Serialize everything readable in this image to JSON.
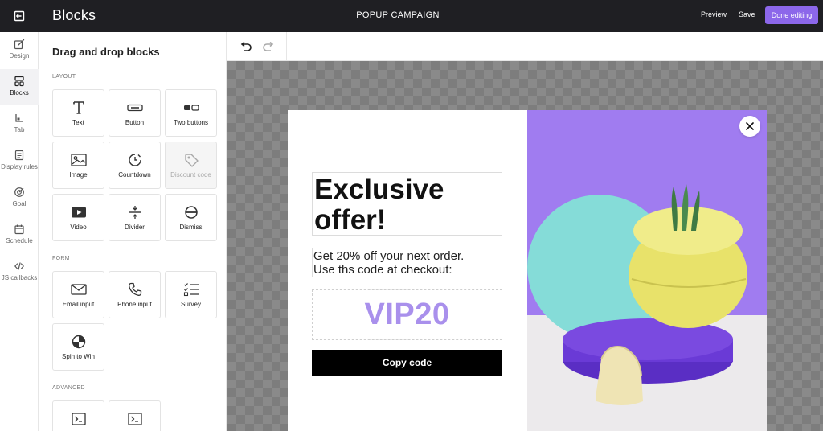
{
  "header": {
    "title": "Blocks",
    "campaign": "POPUP CAMPAIGN",
    "preview_label": "Preview",
    "save_label": "Save",
    "done_label": "Done editing",
    "exit_icon": "exit-icon"
  },
  "rail": {
    "items": [
      {
        "label": "Design",
        "icon": "pen-ruler-icon"
      },
      {
        "label": "Blocks",
        "icon": "blocks-icon",
        "active": true
      },
      {
        "label": "Tab",
        "icon": "tab-icon"
      },
      {
        "label": "Display rules",
        "icon": "document-list-icon"
      },
      {
        "label": "Goal",
        "icon": "target-icon"
      },
      {
        "label": "Schedule",
        "icon": "calendar-icon"
      },
      {
        "label": "JS callbacks",
        "icon": "code-icon"
      }
    ]
  },
  "panel": {
    "title": "Drag and drop blocks",
    "sections": {
      "layout": "LAYOUT",
      "form": "FORM",
      "advanced": "ADVANCED"
    },
    "layout_blocks": [
      {
        "label": "Text",
        "icon": "text-icon"
      },
      {
        "label": "Button",
        "icon": "button-icon"
      },
      {
        "label": "Two buttons",
        "icon": "two-buttons-icon"
      },
      {
        "label": "Image",
        "icon": "image-icon"
      },
      {
        "label": "Countdown",
        "icon": "countdown-icon"
      },
      {
        "label": "Discount code",
        "icon": "tag-icon",
        "disabled": true
      },
      {
        "label": "Video",
        "icon": "video-icon"
      },
      {
        "label": "Divider",
        "icon": "divider-icon"
      },
      {
        "label": "Dismiss",
        "icon": "dismiss-icon"
      }
    ],
    "form_blocks": [
      {
        "label": "Email input",
        "icon": "envelope-icon"
      },
      {
        "label": "Phone input",
        "icon": "phone-icon"
      },
      {
        "label": "Survey",
        "icon": "checklist-icon"
      },
      {
        "label": "Spin to Win",
        "icon": "wheel-icon"
      }
    ],
    "advanced_blocks": [
      {
        "label": "",
        "icon": "terminal-icon"
      },
      {
        "label": "",
        "icon": "terminal-icon"
      }
    ]
  },
  "toolbar": {
    "undo_icon": "undo-icon",
    "redo_icon": "redo-icon"
  },
  "popup": {
    "headline": "Exclusive\noffer!",
    "body": "Get 20% off your next order.\nUse ths code at checkout:",
    "code": "VIP20",
    "copy_label": "Copy code",
    "close_icon": "close-icon"
  },
  "colors": {
    "accent": "#8c67ea",
    "code_text": "#a990ec",
    "topbar": "#1f1f23",
    "popup_bg_right": "#a07cf0",
    "teal_circle": "#85dcd8",
    "purple_pedestal": "#6a3ad6",
    "yellow_vase": "#e8e26a"
  }
}
